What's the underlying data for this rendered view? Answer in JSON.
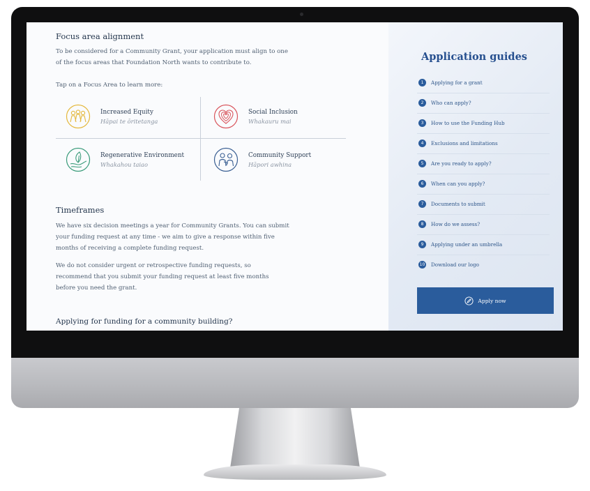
{
  "focus": {
    "heading": "Focus area alignment",
    "intro": "To be considered for a Community Grant, your application must align to one of the focus areas that Foundation North wants to contribute to.",
    "tap_hint": "Tap on a Focus Area to learn more:",
    "areas": [
      {
        "title": "Increased Equity",
        "subtitle": "Hāpai te ōritetanga",
        "icon": "people-group-icon",
        "color": "#e4b83c"
      },
      {
        "title": "Social Inclusion",
        "subtitle": "Whakauru mai",
        "icon": "heart-circles-icon",
        "color": "#d9545b"
      },
      {
        "title": "Regenerative Environment",
        "subtitle": "Whakahou taiao",
        "icon": "leaf-hand-icon",
        "color": "#3a9b7a"
      },
      {
        "title": "Community Support",
        "subtitle": "Hāpori awhina",
        "icon": "support-people-icon",
        "color": "#3a5f93"
      }
    ]
  },
  "timeframes": {
    "heading": "Timeframes",
    "para1": "We have six decision meetings a year for Community Grants. You can submit your funding request at any time - we aim to give a response within five months of receiving a complete funding request.",
    "para2": "We do not consider urgent or retrospective funding requests, so recommend that you submit your funding request at least five months before you need the grant."
  },
  "building_heading": "Applying for funding for a community building?",
  "guides": {
    "title": "Application guides",
    "items": [
      {
        "num": "1",
        "label": "Applying for a grant"
      },
      {
        "num": "2",
        "label": "Who can apply?"
      },
      {
        "num": "3",
        "label": "How to use the Funding Hub"
      },
      {
        "num": "4",
        "label": "Exclusions and limitations"
      },
      {
        "num": "5",
        "label": "Are you ready to apply?"
      },
      {
        "num": "6",
        "label": "When can you apply?"
      },
      {
        "num": "7",
        "label": "Documents to submit"
      },
      {
        "num": "8",
        "label": "How do we assess?"
      },
      {
        "num": "9",
        "label": "Applying under an umbrella"
      },
      {
        "num": "10",
        "label": "Download our logo"
      }
    ],
    "apply_label": "Apply now"
  },
  "colors": {
    "accent": "#2a5c9c",
    "sidebar_bg": "#e3eaf4"
  }
}
